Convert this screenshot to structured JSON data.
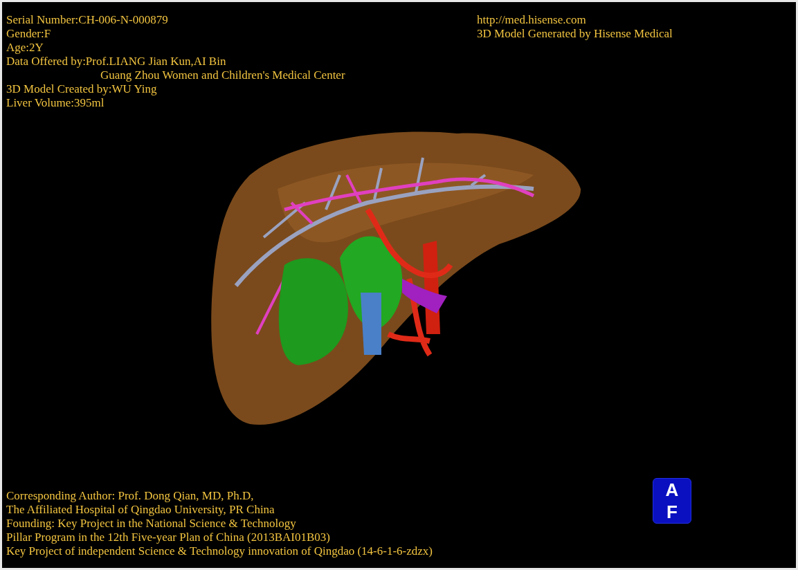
{
  "viewer": {
    "case_info": [
      {
        "kind": "line",
        "text": "Serial Number:CH-006-N-000879"
      },
      {
        "kind": "line",
        "text": "Gender:F"
      },
      {
        "kind": "line",
        "text": "Age:2Y"
      },
      {
        "kind": "line",
        "text": "Data Offered by:Prof.LIANG Jian Kun,AI Bin"
      },
      {
        "kind": "continuation",
        "text": "Guang Zhou Women and Children's Medical Center"
      },
      {
        "kind": "line",
        "text": "3D Model Created by:WU Ying"
      },
      {
        "kind": "line",
        "text": "Liver Volume:395ml"
      }
    ],
    "credits": [
      "http://med.hisense.com",
      "3D Model Generated by Hisense Medical"
    ],
    "footer": [
      "Corresponding Author: Prof. Dong Qian, MD, Ph.D,",
      "The Affiliated Hospital of Qingdao University, PR China",
      "Founding: Key Project in the National Science & Technology",
      "Pillar Program in the 12th Five-year Plan of China (2013BAI01B03)",
      "Key Project of independent Science & Technology innovation of Qingdao (14-6-1-6-zdzx)"
    ],
    "orientation_cube": {
      "top_label": "A",
      "front_label": "F"
    }
  }
}
